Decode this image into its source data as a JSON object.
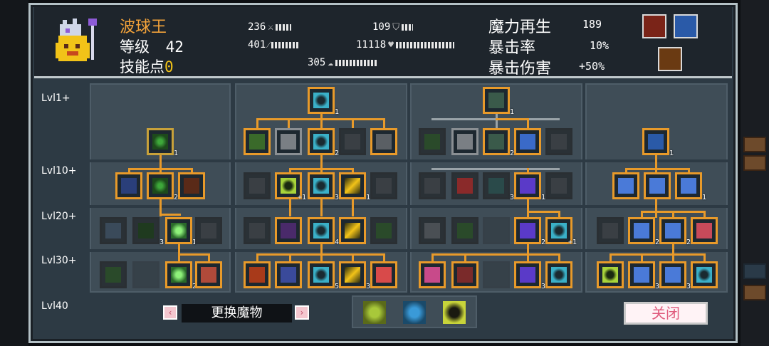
{
  "hero": {
    "name": "波球王",
    "level_label": "等级",
    "level_value": "42",
    "skill_points_label": "技能点",
    "skill_points_value": "0"
  },
  "stats": {
    "attack": "236",
    "weapon_range": "401",
    "defense": "109",
    "hp": "11118",
    "speed": "305"
  },
  "right_stats": {
    "mana_regen_label": "魔力再生",
    "mana_regen_value": "189",
    "crit_rate_label": "暴击率",
    "crit_rate_value": "10%",
    "crit_damage_label": "暴击伤害",
    "crit_damage_value": "+50%"
  },
  "levels": [
    "Lvl1+",
    "Lvl10+",
    "Lvl20+",
    "Lvl30+",
    "Lvl40"
  ],
  "node_counts": {
    "c1_r1": "1",
    "c1_r2b": "2",
    "c1_r3a": "3",
    "c1_r3b": "1",
    "c1_r4": "2",
    "c2_r1": "1",
    "c2_r1c": "2",
    "c2_r2a": "+1",
    "c2_r2b": "3",
    "c2_r2c": "1",
    "c2_r3": "4",
    "c2_r4a": "5",
    "c2_r4b": "3",
    "c3_r1": "1",
    "c3_r1c": "2",
    "c3_r2a": "3",
    "c3_r2b": "1",
    "c3_r3a": "2",
    "c3_r3b": "+1",
    "c3_r4": "3",
    "c4_r1": "1",
    "c4_r2b": "1",
    "c4_r3a": "2",
    "c4_r3b": "2",
    "c4_r4a": "3",
    "c4_r4b": "3"
  },
  "footer": {
    "change_monster": "更换魔物",
    "close": "关闭",
    "prev_arrow": "‹",
    "next_arrow": "›"
  },
  "colors": {
    "accent_orange": "#e89a2a",
    "name_orange": "#f2a23a",
    "close_pink": "#e05b7d"
  }
}
